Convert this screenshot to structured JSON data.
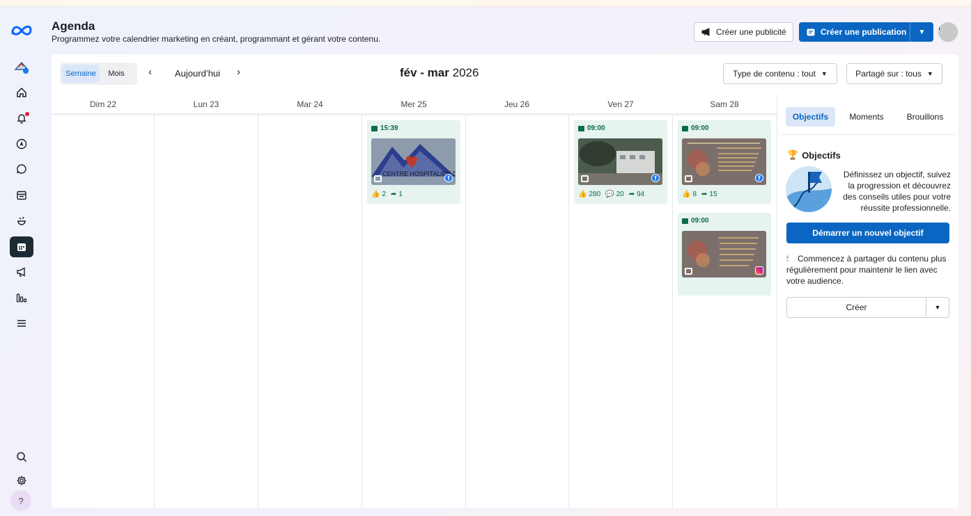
{
  "header": {
    "title": "Agenda",
    "subtitle": "Programmez votre calendrier marketing en créant, programmant et gérant votre contenu.",
    "create_ad_label": "Créer une publicité",
    "create_post_label": "Créer une publication"
  },
  "toolbar": {
    "view_week": "Semaine",
    "view_month": "Mois",
    "today": "Aujourd’hui",
    "range_months": "fév - mar",
    "range_year": "2026",
    "filter_type": "Type de contenu : tout",
    "filter_shared": "Partagé sur : tous"
  },
  "days": [
    "Dim 22",
    "Lun 23",
    "Mar 24",
    "Mer 25",
    "Jeu 26",
    "Ven 27",
    "Sam 28"
  ],
  "posts": [
    {
      "time": "15:39",
      "thumb_text": "CENTRE HOSPITALIER DU PAYS D'APT",
      "network": "facebook",
      "likes": "2",
      "shares": "1"
    },
    {
      "time": "09:00",
      "network": "facebook",
      "likes": "280",
      "comments": "20",
      "shares": "94"
    },
    {
      "time": "09:00",
      "network": "facebook",
      "likes": "8",
      "shares": "15"
    },
    {
      "time": "09:00",
      "network": "instagram"
    }
  ],
  "side_panel": {
    "tabs": [
      "Objectifs",
      "Moments",
      "Brouillons"
    ],
    "objectives_title": "Objectifs",
    "objectives_text": "Définissez un objectif, suivez la progression et découvrez des conseils utiles pour votre réussite professionnelle.",
    "start_button": "Démarrer un nouvel objectif",
    "tip_text": "Commencez à partager du contenu plus régulièrement pour maintenir le lien avec votre audience.",
    "create_button": "Créer"
  },
  "nav": {
    "icons": [
      "meta-logo",
      "page-avatar",
      "home",
      "notifications",
      "explore",
      "messages",
      "content",
      "planner",
      "calendar",
      "ads",
      "insights",
      "menu",
      "search",
      "settings",
      "help"
    ],
    "help_label": "?"
  },
  "colors": {
    "accent": "#0a66c2",
    "card_bg": "#e6f3ee",
    "card_text": "#0b6b4a",
    "rail_active": "#1c2b33"
  }
}
